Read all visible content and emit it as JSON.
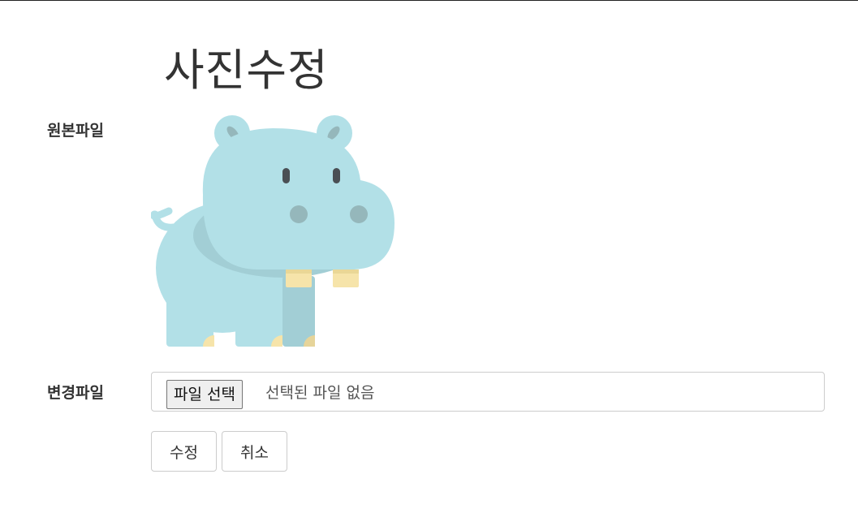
{
  "page": {
    "title": "사진수정"
  },
  "form": {
    "original_label": "원본파일",
    "change_label": "변경파일",
    "original_image": "hippo-illustration",
    "file_input": {
      "button_label": "파일 선택",
      "status_text": "선택된 파일 없음"
    },
    "submit_label": "수정",
    "cancel_label": "취소"
  },
  "colors": {
    "hippo_body": "#b2e0e7",
    "hippo_shade": "#a2ced5",
    "hippo_ear_inner": "#95b7bb",
    "teeth": "#f6e4aa"
  }
}
